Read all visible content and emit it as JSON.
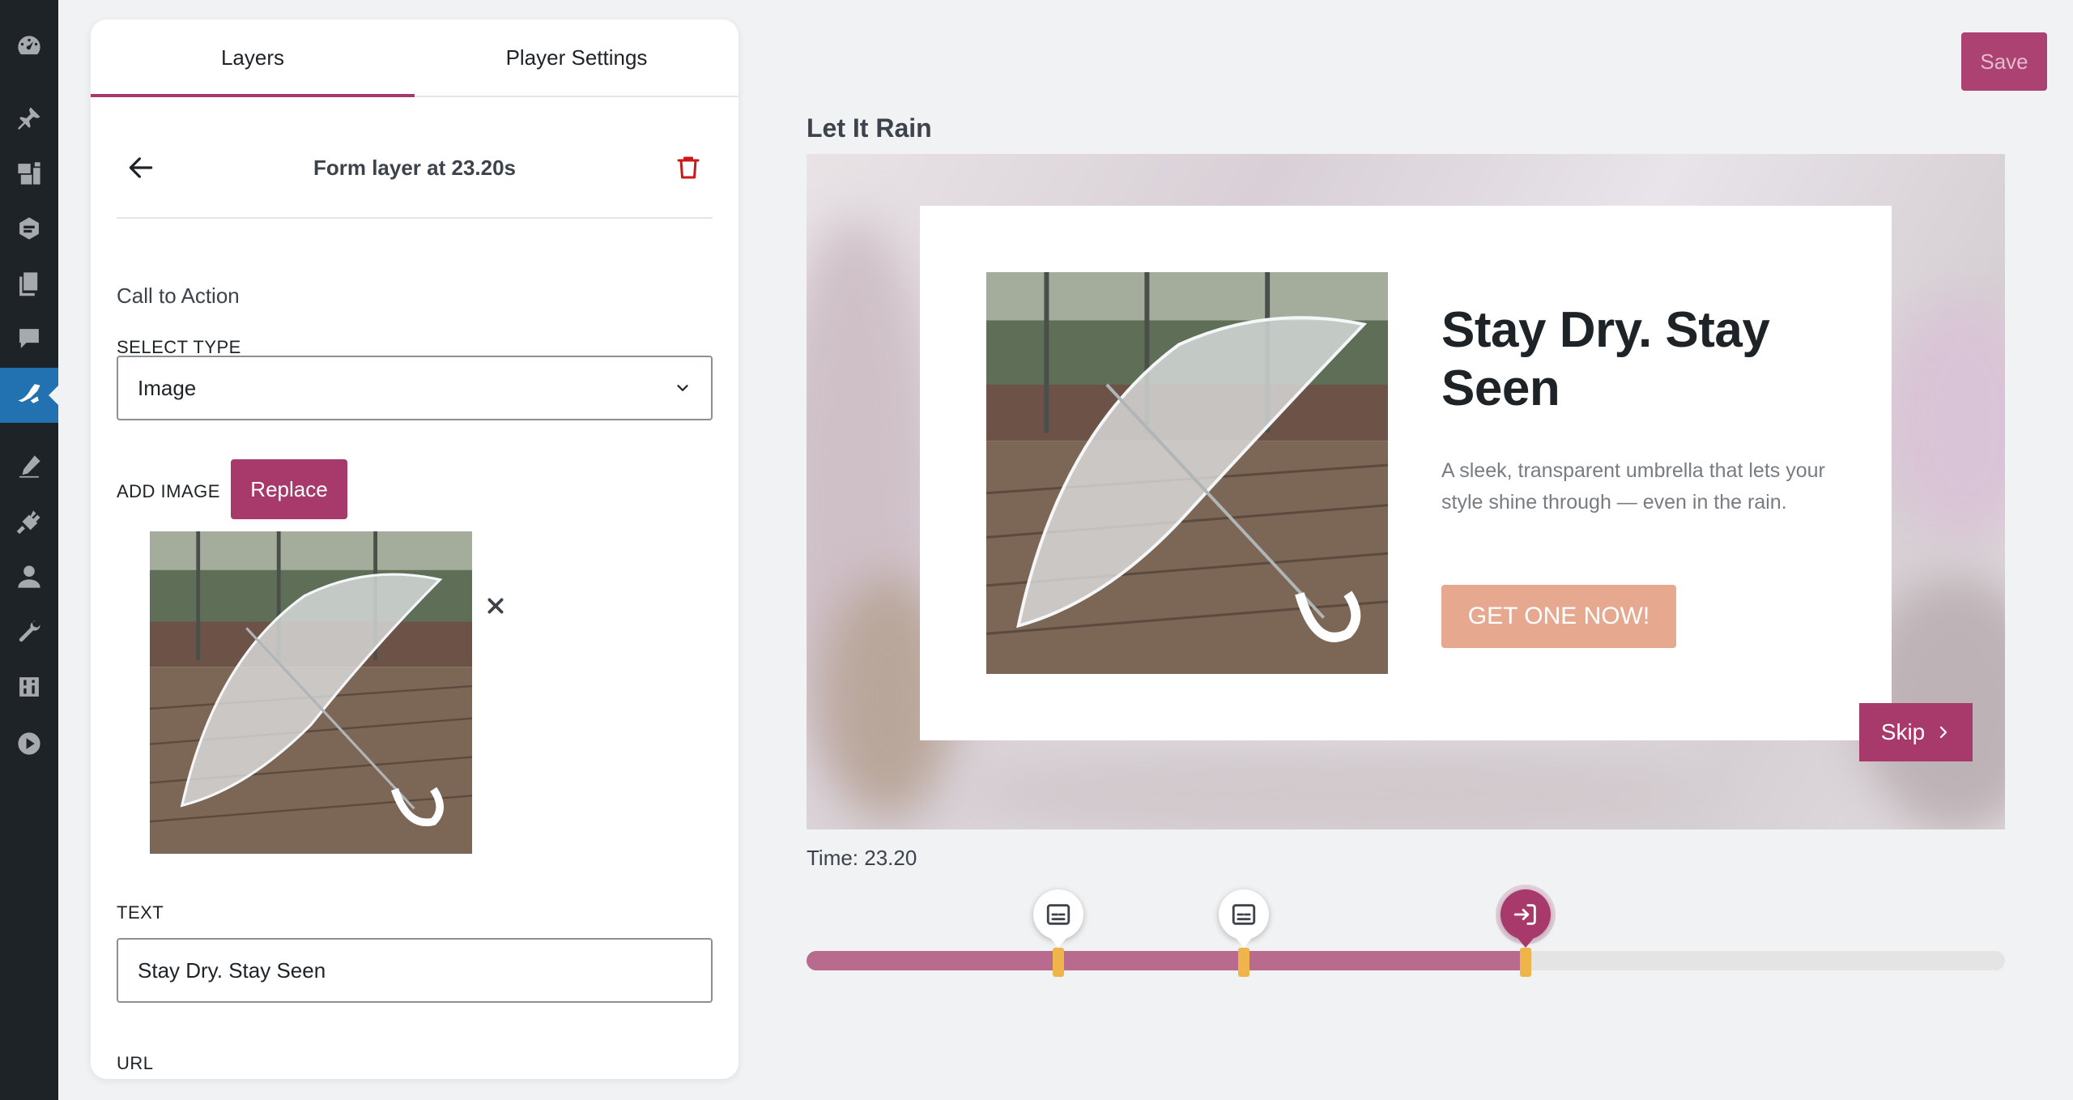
{
  "admin_menu": {
    "icons": [
      "dashboard-icon",
      "pin-icon",
      "media-icon",
      "forms-icon",
      "pages-icon",
      "comments-icon",
      "presto-player-icon",
      "appearance-icon",
      "plugins-icon",
      "users-icon",
      "tools-icon",
      "settings-icon",
      "video-icon"
    ]
  },
  "tabs": [
    {
      "label": "Layers",
      "active": true
    },
    {
      "label": "Player Settings",
      "active": false
    }
  ],
  "layer": {
    "title": "Form layer at 23.20s",
    "section": "Call to Action",
    "select_type_label": "SELECT TYPE",
    "select_type_value": "Image",
    "add_image_label": "ADD IMAGE",
    "replace_label": "Replace",
    "text_label": "TEXT",
    "text_value": "Stay Dry. Stay Seen",
    "url_label": "URL"
  },
  "toolbar": {
    "save_label": "Save"
  },
  "video": {
    "title": "Let It Rain",
    "card": {
      "heading": "Stay Dry. Stay Seen",
      "body": "A sleek, transparent umbrella that lets your style shine through — even in the rain.",
      "cta": "GET ONE NOW!"
    },
    "skip_label": "Skip"
  },
  "timeline": {
    "time_text": "Time: 23.20",
    "progress": 0.6,
    "markers": [
      {
        "type": "caption",
        "position": 0.21,
        "active": false
      },
      {
        "type": "caption",
        "position": 0.365,
        "active": false
      },
      {
        "type": "form",
        "position": 0.6,
        "active": true
      }
    ]
  },
  "colors": {
    "accent": "#a8396b",
    "admin_bar": "#1e2327",
    "admin_active": "#2271b1",
    "cta": "#e6a990",
    "marker": "#f0b54a"
  }
}
